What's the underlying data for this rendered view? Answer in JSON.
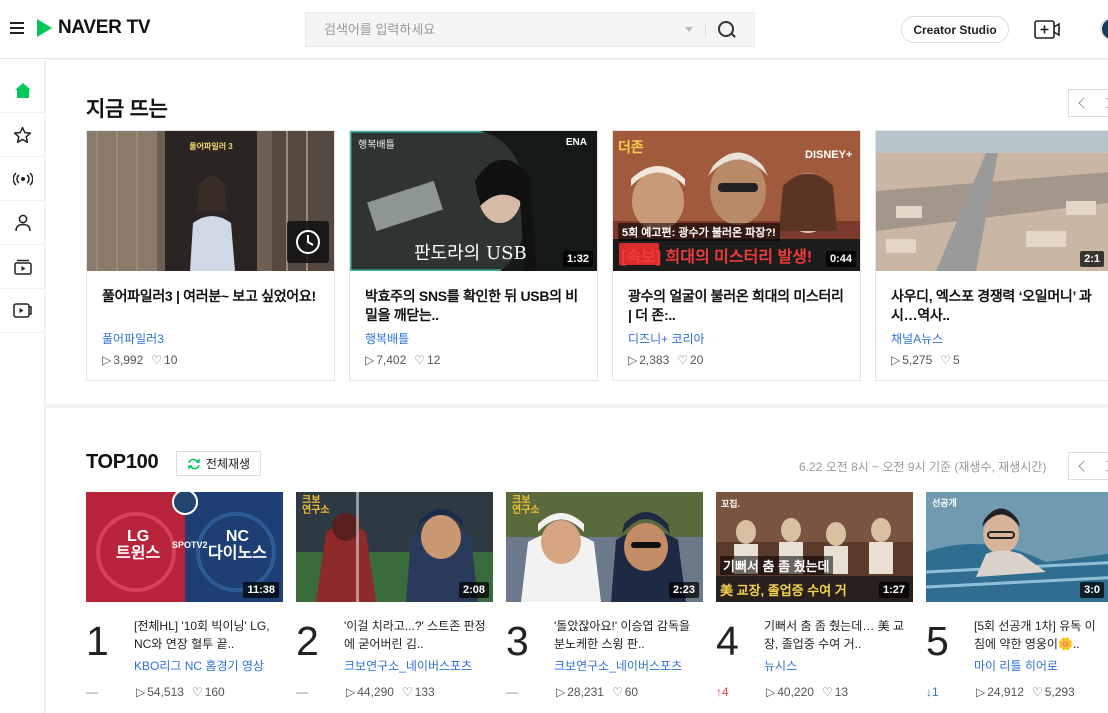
{
  "header": {
    "logo": "NAVER TV",
    "search_placeholder": "검색어를 입력하세요",
    "creator_studio": "Creator Studio"
  },
  "sidebar": {
    "items": [
      "home-icon",
      "star-icon",
      "live-icon",
      "person-icon",
      "playlist-icon",
      "tv-icon"
    ]
  },
  "trending": {
    "title": "지금 뜨는",
    "cards": [
      {
        "title": "풀어파일러3 | 여러분~ 보고 싶었어요!",
        "channel": "풀어파일러3",
        "views": "3,992",
        "likes": "10",
        "duration": "",
        "thumb_text": "풀어파일러 3"
      },
      {
        "title": "박효주의 SNS를 확인한 뒤 USB의 비밀을 깨닫는..",
        "channel": "행복배틀",
        "views": "7,402",
        "likes": "12",
        "duration": "1:32",
        "thumb_text": "판도라의 USB"
      },
      {
        "title": "광수의 얼굴이 불러온 희대의 미스터리 | 더 존:..",
        "channel": "디즈니+ 코리아",
        "views": "2,383",
        "likes": "20",
        "duration": "0:44",
        "thumb_text": "[속보] 희대의 미스터리 발생!"
      },
      {
        "title": "사우디, 엑스포 경쟁력 ‘오일머니’ 과시…역사..",
        "channel": "채널A뉴스",
        "views": "5,275",
        "likes": "5",
        "duration": "2:1",
        "thumb_text": ""
      }
    ]
  },
  "top100": {
    "title": "TOP100",
    "play_all": "전체재생",
    "basis": "6.22 오전 8시 ~ 오전 9시 기준 (재생수, 재생시간)",
    "items": [
      {
        "rank": "1",
        "title": "[전체HL] '10회 빅이닝' LG, NC와 연장 혈투 끝..",
        "channel": "KBO리그 NC 홈경기 영상",
        "change": "—",
        "views": "54,513",
        "likes": "160",
        "duration": "11:38"
      },
      {
        "rank": "2",
        "title": "'이걸 치라고...?' 스트존 판정에 굳어버린 김..",
        "channel": "크보연구소_네이버스포츠",
        "change": "—",
        "views": "44,290",
        "likes": "133",
        "duration": "2:08"
      },
      {
        "rank": "3",
        "title": "'돌았잖아요!' 이승엽 감독을 분노케한 스윙 판..",
        "channel": "크보연구소_네이버스포츠",
        "change": "—",
        "views": "28,231",
        "likes": "60",
        "duration": "2:23"
      },
      {
        "rank": "4",
        "title": "기뻐서 춤 좀 췄는데… 美 교장, 졸업중 수여 거..",
        "channel": "뉴시스",
        "change": "↑4",
        "views": "40,220",
        "likes": "13",
        "duration": "1:27"
      },
      {
        "rank": "5",
        "title": "[5회 선공개 1차] 유독 이 침에 약한 영웅이🌼..",
        "channel": "마이 리틀 히어로",
        "change": "↓1",
        "views": "24,912",
        "likes": "5,293",
        "duration": "3:0"
      }
    ]
  },
  "colors": {
    "brand": "#03c75a",
    "link": "#2f72d4",
    "up": "#e0434a",
    "down": "#2f72d4"
  }
}
